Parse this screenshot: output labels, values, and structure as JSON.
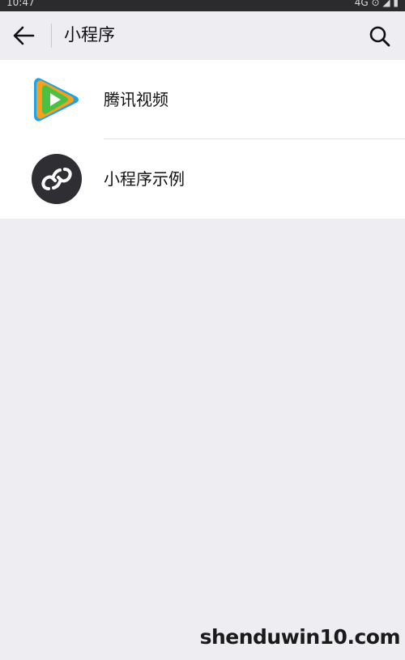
{
  "status_bar": {
    "time": "10:47",
    "indicators": "4G ⊙ ◢ ▮"
  },
  "header": {
    "back_icon": "arrow-left-icon",
    "title": "小程序",
    "search_icon": "search-icon"
  },
  "mini_programs": [
    {
      "name": "腾讯视频",
      "icon": "tencent-video-icon"
    },
    {
      "name": "小程序示例",
      "icon": "mini-program-icon"
    }
  ],
  "watermark": {
    "text": "shenduwin10.com"
  },
  "colors": {
    "background": "#ededf2",
    "list_background": "#ffffff",
    "status_bar": "#2b2b2e",
    "mini_program_icon_bg": "#2f2f33"
  }
}
